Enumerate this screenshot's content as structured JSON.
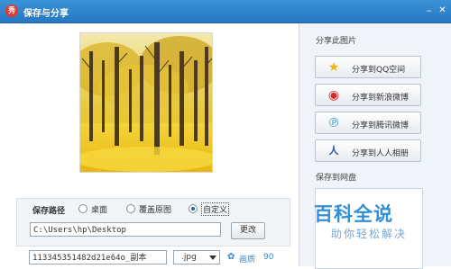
{
  "window": {
    "title": "保存与分享",
    "app_icon_glyph": "秀"
  },
  "save": {
    "label": "保存路径",
    "options": [
      "桌面",
      "覆盖原图",
      "自定义"
    ],
    "selected_index": 2,
    "path_value": "C:\\Users\\hp\\Desktop",
    "change_button": "更改",
    "filename_value": "113345351482d21e64o_副本",
    "format_value": ".jpg",
    "quality_label": "画质",
    "quality_value": "90"
  },
  "share": {
    "header": "分享此图片",
    "buttons": [
      {
        "label": "分享到QQ空间",
        "icon": "star-icon"
      },
      {
        "label": "分享到新浪微博",
        "icon": "weibo-icon"
      },
      {
        "label": "分享到腾讯微博",
        "icon": "tencent-weibo-icon"
      },
      {
        "label": "分享到人人相册",
        "icon": "renren-icon"
      }
    ],
    "cloud_header": "保存到网盘"
  },
  "watermark": {
    "logo": "百科全说",
    "sub": "助你轻松解决"
  },
  "colors": {
    "titlebar": "#2a7ec6",
    "accent": "#3a86d4",
    "panel": "#eef4fa",
    "foliage": "#e8c21a"
  }
}
